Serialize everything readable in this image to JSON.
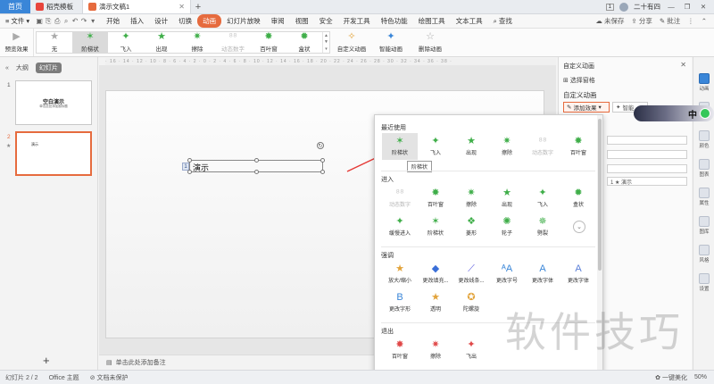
{
  "titlebar": {
    "home_tab": "首页",
    "template_tab": "稻壳模板",
    "doc_tab": "演示文稿1",
    "user_name": "二十有四",
    "page_badge": "1",
    "minimize": "—",
    "restore": "❐",
    "close": "✕"
  },
  "menubar": {
    "file_label": "文件",
    "items": [
      "开始",
      "插入",
      "设计",
      "切换",
      "动画",
      "幻灯片放映",
      "审阅",
      "视图",
      "安全",
      "开发工具",
      "特色功能",
      "绘图工具",
      "文本工具"
    ],
    "active_index": 4,
    "search_label": "查找",
    "save_status": "未保存",
    "share_label": "分享",
    "batch_label": "批注"
  },
  "ribbon": {
    "preview_label": "预览效果",
    "effects": [
      {
        "label": "无",
        "icon": "star-grey-icon"
      },
      {
        "label": "阶梯状",
        "icon": "star-green-steps-icon"
      },
      {
        "label": "飞入",
        "icon": "star-fly-icon"
      },
      {
        "label": "出现",
        "icon": "star-green-icon"
      },
      {
        "label": "擦除",
        "icon": "star-wipe-icon"
      },
      {
        "label": "动态数字",
        "icon": "number-faded-icon"
      },
      {
        "label": "百叶窗",
        "icon": "star-blinds-icon"
      },
      {
        "label": "盒状",
        "icon": "star-box-icon"
      }
    ],
    "selected_effect": 1,
    "custom_anim_label": "自定义动画",
    "smart_anim_label": "智能动画",
    "delete_anim_label": "删除动画"
  },
  "leftpanel": {
    "tab_outline": "大纲",
    "tab_slides": "幻灯片",
    "slide1_num": "1",
    "slide1_title": "空白演示",
    "slide1_sub": "单击此处添加副标题",
    "slide2_num": "2",
    "slide2_text": "演示",
    "add_slide": "+"
  },
  "ruler": {
    "text": "· 16 · 14 · 12 · 10 · 8 · 6 · 4 · 2 · 0 · 2 · 4 · 6 · 8 · 10 · 12 · 14 · 16 · 18 · 20 · 22 · 24 · 26 · 28 · 30 · 32 · 34 · 36 · 38 ·"
  },
  "canvas": {
    "textbox_label": "1",
    "textbox_text": "演示",
    "notes_placeholder": "单击此处添加备注"
  },
  "taskpane": {
    "title": "自定义动画",
    "select_pane": "选择窗格",
    "heading": "自定义动画",
    "add_effect": "添加效果",
    "smart": "智能",
    "field_text": "1 ★ 演示"
  },
  "rail": {
    "items": [
      "动画",
      "艺术字",
      "颜色",
      "图表",
      "属性",
      "图库",
      "风格",
      "设置"
    ]
  },
  "ime": {
    "char": "中"
  },
  "popup": {
    "section_recent": "最近使用",
    "recent": [
      {
        "label": "阶梯状",
        "icon": "star-green-steps-icon"
      },
      {
        "label": "飞入",
        "icon": "star-fly-icon"
      },
      {
        "label": "出现",
        "icon": "star-green-icon"
      },
      {
        "label": "擦除",
        "icon": "star-wipe-icon"
      },
      {
        "label": "动态数字",
        "icon": "number-faded-icon"
      },
      {
        "label": "百叶窗",
        "icon": "star-blinds-icon"
      }
    ],
    "tooltip": "阶梯状",
    "section_enter": "进入",
    "enter_row1": [
      {
        "label": "动态数字",
        "icon": "number-faded-icon"
      },
      {
        "label": "百叶窗",
        "icon": "star-blinds-icon"
      },
      {
        "label": "擦除",
        "icon": "star-wipe-icon"
      },
      {
        "label": "出现",
        "icon": "star-green-icon"
      },
      {
        "label": "飞入",
        "icon": "star-fly-icon"
      },
      {
        "label": "盒状",
        "icon": "star-box-icon"
      }
    ],
    "enter_row2": [
      {
        "label": "缓慢进入",
        "icon": "star-slow-icon"
      },
      {
        "label": "阶梯状",
        "icon": "star-green-steps-icon"
      },
      {
        "label": "菱形",
        "icon": "star-diamond-icon"
      },
      {
        "label": "轮子",
        "icon": "star-wheel-icon"
      },
      {
        "label": "劈裂",
        "icon": "star-split-icon"
      }
    ],
    "section_emphasis": "强调",
    "emphasis_row1": [
      {
        "label": "放大/缩小",
        "icon": "star-orange-icon"
      },
      {
        "label": "更改填充...",
        "icon": "fill-icon"
      },
      {
        "label": "更改线条...",
        "icon": "line-icon"
      },
      {
        "label": "更改字号",
        "icon": "font-size-icon"
      },
      {
        "label": "更改字体",
        "icon": "font-icon"
      },
      {
        "label": "更改字体",
        "icon": "font-color-icon"
      }
    ],
    "emphasis_row2": [
      {
        "label": "更改字形",
        "icon": "bold-icon"
      },
      {
        "label": "透明",
        "icon": "star-orange-icon"
      },
      {
        "label": "陀螺旋",
        "icon": "star-orange-spin-icon"
      }
    ],
    "section_exit": "退出",
    "exit_row1": [
      {
        "label": "百叶窗",
        "icon": "star-red-blinds-icon"
      },
      {
        "label": "擦除",
        "icon": "star-red-wipe-icon"
      },
      {
        "label": "飞出",
        "icon": "star-red-fly-icon"
      }
    ]
  },
  "statusbar": {
    "slide_count": "幻灯片 2 / 2",
    "theme": "Office 主题",
    "protect": "文档未保护",
    "beautify": "一键美化",
    "zoom": "50%"
  },
  "watermark": "软件技巧",
  "colors": {
    "accent": "#e66b3e",
    "home_tab": "#3a86d8",
    "green_star": "#3fae49"
  }
}
